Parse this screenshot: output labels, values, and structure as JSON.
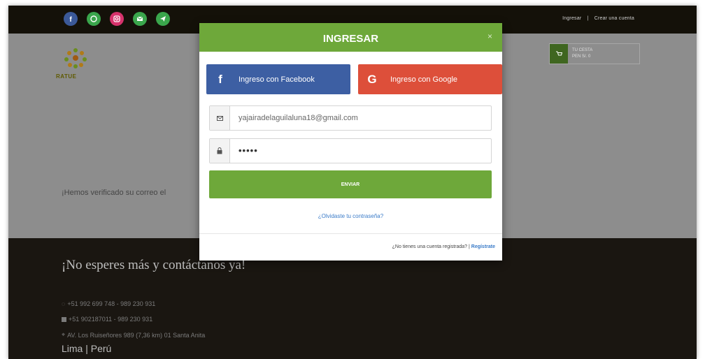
{
  "topbar": {
    "social": [
      {
        "icon": "facebook-icon",
        "color": "#3b5998"
      },
      {
        "icon": "whatsapp-icon",
        "color": "#3aa64c"
      },
      {
        "icon": "instagram-icon",
        "color": "#d6336c"
      },
      {
        "icon": "mail-icon",
        "color": "#3aa64c"
      },
      {
        "icon": "send-icon",
        "color": "#3aa64c"
      }
    ],
    "login_link": "Ingresar",
    "separator": "|",
    "register_link": "Crear una cuenta"
  },
  "header": {
    "logo_text": "RATUE",
    "cart_line1": "TU CESTA",
    "cart_line2": "PEN S/. 0"
  },
  "page": {
    "verified_message": "¡Hemos verificado su correo el"
  },
  "modal": {
    "title": "INGRESAR",
    "close": "×",
    "facebook_icon": "f",
    "facebook_label": "Ingreso con Facebook",
    "google_icon": "G",
    "google_label": "Ingreso con Google",
    "email_value": "yajairadelaguilaluna18@gmail.com",
    "password_mask": "•••••",
    "submit_label": "ENVIAR",
    "forgot_link": "¿Olvidaste tu contraseña?",
    "no_account_text": "¿No tienes una cuenta registrada? |",
    "register_link": "Regístrate"
  },
  "footer": {
    "title": "¡No esperes más y contáctanos ya!",
    "phone1": "+51 992 699 748 - 989 230 931",
    "phone2": "+51 902187011 - 989 230 931",
    "address": "AV. Los Ruiseñores 989 (7,36 km) 01 Santa Anita",
    "city": "Lima | Perú"
  },
  "colors": {
    "accent_green": "#6ea83a",
    "facebook_blue": "#3d5fa3",
    "google_red": "#dd4f3a",
    "topbar_bg": "#141109",
    "footer_bg": "#1a1611"
  }
}
